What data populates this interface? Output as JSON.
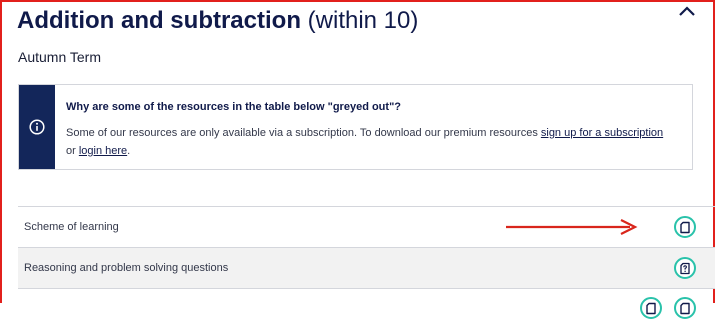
{
  "header": {
    "title_bold": "Addition and subtraction",
    "title_light": "(within 10)",
    "term": "Autumn Term",
    "collapse_icon": "chevron-up-icon"
  },
  "notice": {
    "icon": "info-icon",
    "title": "Why are some of the resources in the table below \"greyed out\"?",
    "body_text": "Some of our resources are only available via a subscription.  To download our premium resources ",
    "signup_link": "sign up for a subscription",
    "or_text": " or ",
    "login_link": "login here",
    "end_text": "."
  },
  "resources": [
    {
      "label": "Scheme of learning",
      "icon": "document-icon"
    },
    {
      "label": "Reasoning and problem solving questions",
      "icon": "question-document-icon"
    },
    {
      "label": "",
      "icon": "document-icon"
    }
  ],
  "annotation": {
    "color": "#e2201c",
    "icon": "red-arrow-right"
  },
  "colors": {
    "navy": "#13265a",
    "teal": "#29c2aa",
    "red_border": "#e2201c"
  }
}
